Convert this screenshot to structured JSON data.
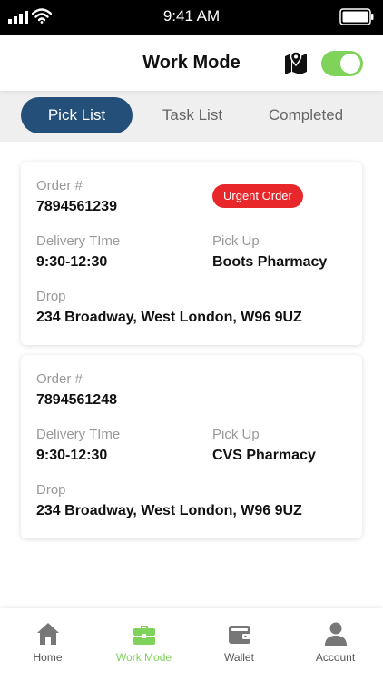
{
  "status_bar": {
    "time": "9:41 AM"
  },
  "header": {
    "title": "Work Mode",
    "toggle_on": true
  },
  "tabs": [
    {
      "label": "Pick List",
      "active": true
    },
    {
      "label": "Task List",
      "active": false
    },
    {
      "label": "Completed",
      "active": false
    }
  ],
  "orders": [
    {
      "order_label": "Order #",
      "order_number": "7894561239",
      "badge": "Urgent Order",
      "delivery_label": "Delivery TIme",
      "delivery_time": "9:30-12:30",
      "pickup_label": "Pick Up",
      "pickup": "Boots Pharmacy",
      "drop_label": "Drop",
      "drop": "234 Broadway, West London, W96 9UZ"
    },
    {
      "order_label": "Order #",
      "order_number": "7894561248",
      "delivery_label": "Delivery TIme",
      "delivery_time": "9:30-12:30",
      "pickup_label": "Pick Up",
      "pickup": "CVS Pharmacy",
      "drop_label": "Drop",
      "drop": "234 Broadway, West London, W96 9UZ"
    }
  ],
  "bottom_nav": [
    {
      "label": "Home",
      "icon": "home-icon",
      "active": false
    },
    {
      "label": "Work Mode",
      "icon": "briefcase-icon",
      "active": true
    },
    {
      "label": "Wallet",
      "icon": "wallet-icon",
      "active": false
    },
    {
      "label": "Account",
      "icon": "user-icon",
      "active": false
    }
  ],
  "colors": {
    "primary": "#234f78",
    "accent": "#7fd35a",
    "urgent": "#e8272b"
  }
}
